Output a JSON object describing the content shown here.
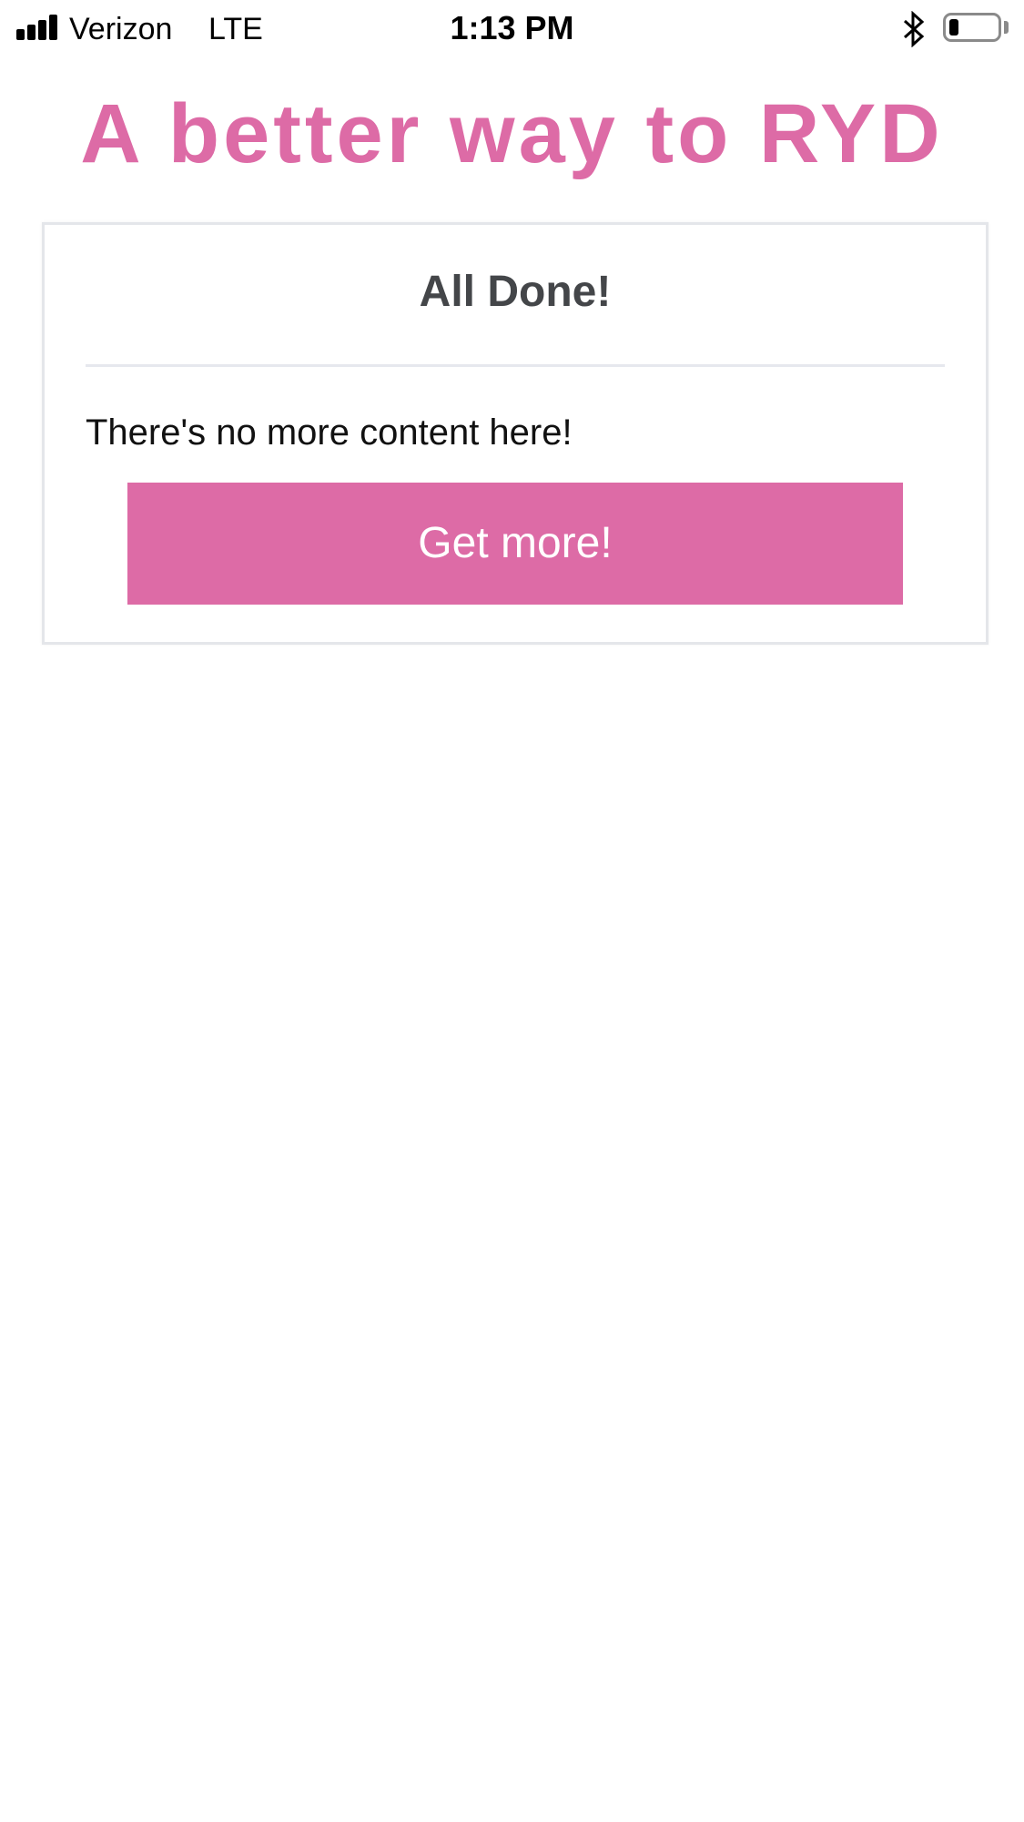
{
  "status_bar": {
    "carrier": "Verizon",
    "network": "LTE",
    "time": "1:13 PM",
    "signal_bars": 4,
    "battery_level": 0.2,
    "bluetooth_icon": "bluetooth-icon"
  },
  "header": {
    "title": "A better way to RYD"
  },
  "card": {
    "title": "All Done!",
    "message": "There's no more content here!",
    "button_label": "Get more!"
  },
  "colors": {
    "accent": "#dd6ba6",
    "card_title": "#444649",
    "card_border": "#e4e6ea"
  }
}
